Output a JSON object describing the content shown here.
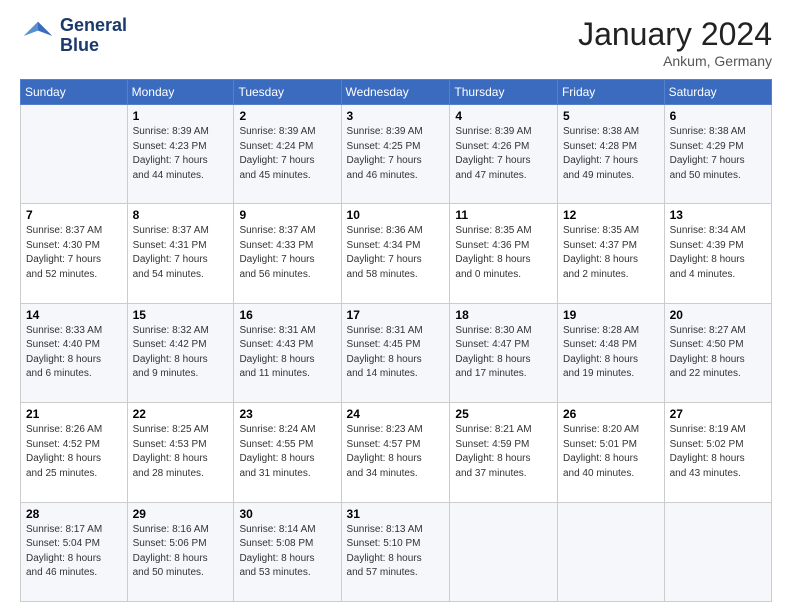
{
  "header": {
    "logo_line1": "General",
    "logo_line2": "Blue",
    "month": "January 2024",
    "location": "Ankum, Germany"
  },
  "days_of_week": [
    "Sunday",
    "Monday",
    "Tuesday",
    "Wednesday",
    "Thursday",
    "Friday",
    "Saturday"
  ],
  "weeks": [
    [
      {
        "day": "",
        "info": ""
      },
      {
        "day": "1",
        "info": "Sunrise: 8:39 AM\nSunset: 4:23 PM\nDaylight: 7 hours\nand 44 minutes."
      },
      {
        "day": "2",
        "info": "Sunrise: 8:39 AM\nSunset: 4:24 PM\nDaylight: 7 hours\nand 45 minutes."
      },
      {
        "day": "3",
        "info": "Sunrise: 8:39 AM\nSunset: 4:25 PM\nDaylight: 7 hours\nand 46 minutes."
      },
      {
        "day": "4",
        "info": "Sunrise: 8:39 AM\nSunset: 4:26 PM\nDaylight: 7 hours\nand 47 minutes."
      },
      {
        "day": "5",
        "info": "Sunrise: 8:38 AM\nSunset: 4:28 PM\nDaylight: 7 hours\nand 49 minutes."
      },
      {
        "day": "6",
        "info": "Sunrise: 8:38 AM\nSunset: 4:29 PM\nDaylight: 7 hours\nand 50 minutes."
      }
    ],
    [
      {
        "day": "7",
        "info": "Sunrise: 8:37 AM\nSunset: 4:30 PM\nDaylight: 7 hours\nand 52 minutes."
      },
      {
        "day": "8",
        "info": "Sunrise: 8:37 AM\nSunset: 4:31 PM\nDaylight: 7 hours\nand 54 minutes."
      },
      {
        "day": "9",
        "info": "Sunrise: 8:37 AM\nSunset: 4:33 PM\nDaylight: 7 hours\nand 56 minutes."
      },
      {
        "day": "10",
        "info": "Sunrise: 8:36 AM\nSunset: 4:34 PM\nDaylight: 7 hours\nand 58 minutes."
      },
      {
        "day": "11",
        "info": "Sunrise: 8:35 AM\nSunset: 4:36 PM\nDaylight: 8 hours\nand 0 minutes."
      },
      {
        "day": "12",
        "info": "Sunrise: 8:35 AM\nSunset: 4:37 PM\nDaylight: 8 hours\nand 2 minutes."
      },
      {
        "day": "13",
        "info": "Sunrise: 8:34 AM\nSunset: 4:39 PM\nDaylight: 8 hours\nand 4 minutes."
      }
    ],
    [
      {
        "day": "14",
        "info": "Sunrise: 8:33 AM\nSunset: 4:40 PM\nDaylight: 8 hours\nand 6 minutes."
      },
      {
        "day": "15",
        "info": "Sunrise: 8:32 AM\nSunset: 4:42 PM\nDaylight: 8 hours\nand 9 minutes."
      },
      {
        "day": "16",
        "info": "Sunrise: 8:31 AM\nSunset: 4:43 PM\nDaylight: 8 hours\nand 11 minutes."
      },
      {
        "day": "17",
        "info": "Sunrise: 8:31 AM\nSunset: 4:45 PM\nDaylight: 8 hours\nand 14 minutes."
      },
      {
        "day": "18",
        "info": "Sunrise: 8:30 AM\nSunset: 4:47 PM\nDaylight: 8 hours\nand 17 minutes."
      },
      {
        "day": "19",
        "info": "Sunrise: 8:28 AM\nSunset: 4:48 PM\nDaylight: 8 hours\nand 19 minutes."
      },
      {
        "day": "20",
        "info": "Sunrise: 8:27 AM\nSunset: 4:50 PM\nDaylight: 8 hours\nand 22 minutes."
      }
    ],
    [
      {
        "day": "21",
        "info": "Sunrise: 8:26 AM\nSunset: 4:52 PM\nDaylight: 8 hours\nand 25 minutes."
      },
      {
        "day": "22",
        "info": "Sunrise: 8:25 AM\nSunset: 4:53 PM\nDaylight: 8 hours\nand 28 minutes."
      },
      {
        "day": "23",
        "info": "Sunrise: 8:24 AM\nSunset: 4:55 PM\nDaylight: 8 hours\nand 31 minutes."
      },
      {
        "day": "24",
        "info": "Sunrise: 8:23 AM\nSunset: 4:57 PM\nDaylight: 8 hours\nand 34 minutes."
      },
      {
        "day": "25",
        "info": "Sunrise: 8:21 AM\nSunset: 4:59 PM\nDaylight: 8 hours\nand 37 minutes."
      },
      {
        "day": "26",
        "info": "Sunrise: 8:20 AM\nSunset: 5:01 PM\nDaylight: 8 hours\nand 40 minutes."
      },
      {
        "day": "27",
        "info": "Sunrise: 8:19 AM\nSunset: 5:02 PM\nDaylight: 8 hours\nand 43 minutes."
      }
    ],
    [
      {
        "day": "28",
        "info": "Sunrise: 8:17 AM\nSunset: 5:04 PM\nDaylight: 8 hours\nand 46 minutes."
      },
      {
        "day": "29",
        "info": "Sunrise: 8:16 AM\nSunset: 5:06 PM\nDaylight: 8 hours\nand 50 minutes."
      },
      {
        "day": "30",
        "info": "Sunrise: 8:14 AM\nSunset: 5:08 PM\nDaylight: 8 hours\nand 53 minutes."
      },
      {
        "day": "31",
        "info": "Sunrise: 8:13 AM\nSunset: 5:10 PM\nDaylight: 8 hours\nand 57 minutes."
      },
      {
        "day": "",
        "info": ""
      },
      {
        "day": "",
        "info": ""
      },
      {
        "day": "",
        "info": ""
      }
    ]
  ]
}
